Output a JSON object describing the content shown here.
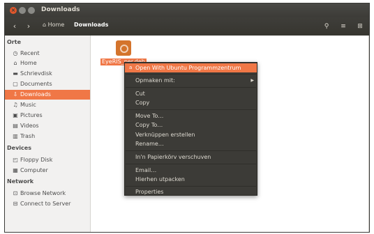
{
  "window": {
    "title": "Downloads"
  },
  "toolbar": {
    "back_icon": "‹",
    "forward_icon": "›",
    "home_label": "Home",
    "current_label": "Downloads",
    "search_icon": "🔍",
    "menu_icon": "≡",
    "grid_icon": "⊞"
  },
  "sidebar": {
    "places_heading": "Orte",
    "places": [
      {
        "label": "Recent",
        "icon": "◷"
      },
      {
        "label": "Home",
        "icon": "⌂"
      },
      {
        "label": "Schrievdisk",
        "icon": "▬"
      },
      {
        "label": "Documents",
        "icon": "▢"
      },
      {
        "label": "Downloads",
        "icon": "⇩"
      },
      {
        "label": "Music",
        "icon": "♫"
      },
      {
        "label": "Pictures",
        "icon": "▣"
      },
      {
        "label": "Videos",
        "icon": "▤"
      },
      {
        "label": "Trash",
        "icon": "▥"
      }
    ],
    "devices_heading": "Devices",
    "devices": [
      {
        "label": "Floppy Disk",
        "icon": "◰"
      },
      {
        "label": "Computer",
        "icon": "▦"
      }
    ],
    "network_heading": "Network",
    "network": [
      {
        "label": "Browse Network",
        "icon": "⊡"
      },
      {
        "label": "Connect to Server",
        "icon": "⊟"
      }
    ]
  },
  "file": {
    "label": "EyeRIS_per.deb"
  },
  "context_menu": {
    "items": [
      {
        "label": "Open With Ubuntu Programmzentrum"
      },
      {
        "label": "Opmaken mit:"
      },
      {
        "label": "Cut"
      },
      {
        "label": "Copy"
      },
      {
        "label": "Move To…"
      },
      {
        "label": "Copy To…"
      },
      {
        "label": "Verknüppen erstellen"
      },
      {
        "label": "Rename…"
      },
      {
        "label": "In'n Papierkörv verschuven"
      },
      {
        "label": "Email…"
      },
      {
        "label": "Hierhen utpacken"
      },
      {
        "label": "Properties"
      }
    ]
  }
}
